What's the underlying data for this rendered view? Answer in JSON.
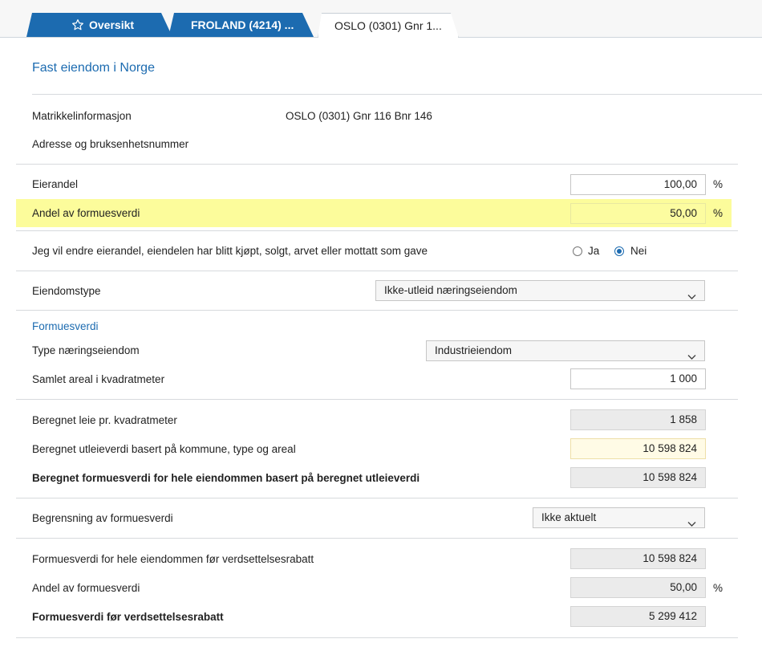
{
  "tabs": [
    {
      "label": "Oversikt",
      "icon": "star-icon"
    },
    {
      "label": "FROLAND (4214) ..."
    },
    {
      "label": "OSLO (0301) Gnr 1..."
    }
  ],
  "page": {
    "title": "Fast eiendom i Norge",
    "matrikkel_label": "Matrikkelinformasjon",
    "matrikkel_value": "OSLO (0301) Gnr 116 Bnr 146",
    "adresse_label": "Adresse og bruksenhetsnummer"
  },
  "eierandel": {
    "label": "Eierandel",
    "value": "100,00",
    "unit": "%"
  },
  "andel_formuesverdi": {
    "label": "Andel av formuesverdi",
    "value": "50,00",
    "unit": "%"
  },
  "endre": {
    "label": "Jeg vil endre eierandel, eiendelen har blitt kjøpt, solgt, arvet eller mottatt som gave",
    "option_yes": "Ja",
    "option_no": "Nei",
    "selected": "Nei"
  },
  "eiendomstype": {
    "label": "Eiendomstype",
    "value": "Ikke-utleid næringseiendom"
  },
  "formuesverdi_heading": "Formuesverdi",
  "type_naering": {
    "label": "Type næringseiendom",
    "value": "Industrieiendom"
  },
  "areal": {
    "label": "Samlet areal i kvadratmeter",
    "value": "1 000"
  },
  "leie_kvm": {
    "label": "Beregnet leie pr. kvadratmeter",
    "value": "1 858"
  },
  "utleieverdi": {
    "label": "Beregnet utleieverdi basert på kommune, type og areal",
    "value": "10 598 824"
  },
  "formuesverdi_hele": {
    "label": "Beregnet formuesverdi for hele eiendommen basert på beregnet utleieverdi",
    "value": "10 598 824"
  },
  "begrensning": {
    "label": "Begrensning av formuesverdi",
    "value": "Ikke aktuelt"
  },
  "fv_for_rabatt": {
    "label": "Formuesverdi for hele eiendommen før verdsettelsesrabatt",
    "value": "10 598 824"
  },
  "andel_formuesverdi2": {
    "label": "Andel av formuesverdi",
    "value": "50,00",
    "unit": "%"
  },
  "fv_for_verdsettelse": {
    "label": "Formuesverdi før verdsettelsesrabatt",
    "value": "5 299 412"
  },
  "colors": {
    "accent": "#1c6bb0",
    "highlight": "#fcfc9b"
  }
}
